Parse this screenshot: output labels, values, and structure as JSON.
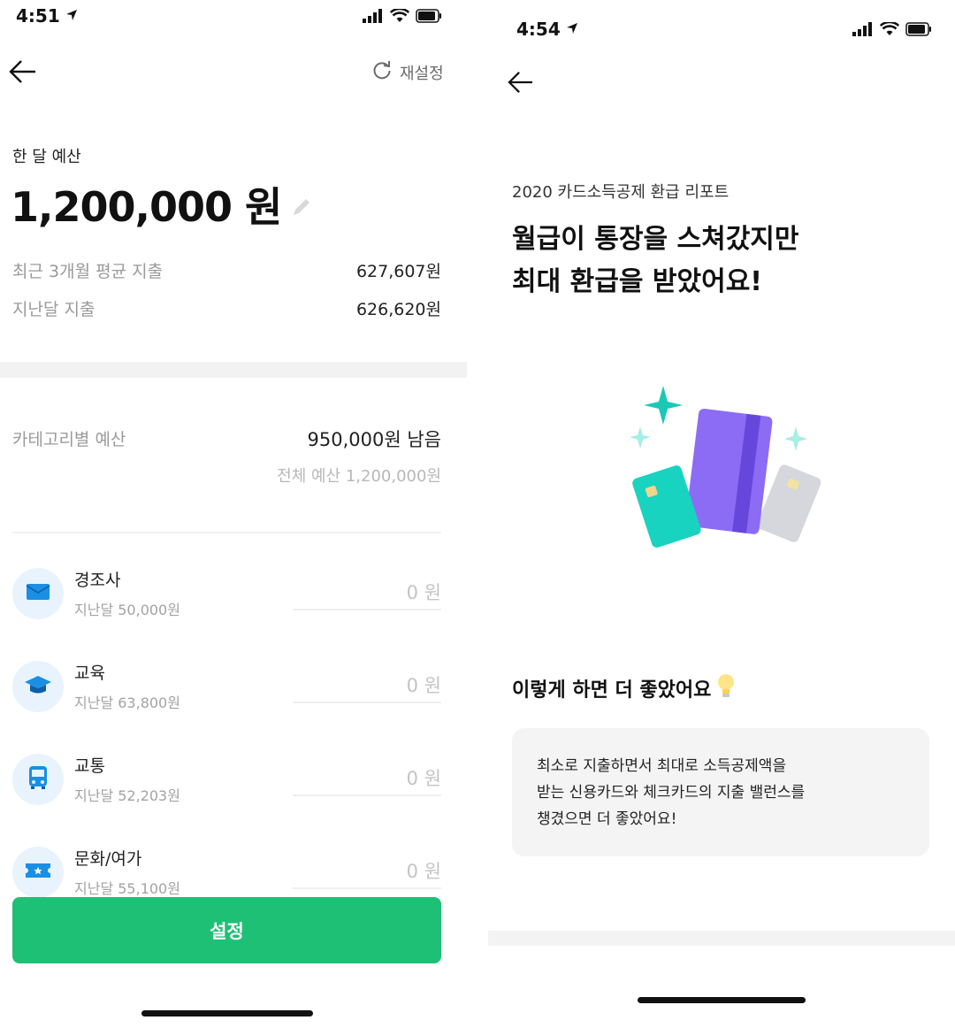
{
  "left": {
    "status": {
      "time": "4:51"
    },
    "header": {
      "reset_label": "재설정"
    },
    "budget": {
      "label": "한 달 예산",
      "amount": "1,200,000 원"
    },
    "stats": [
      {
        "label": "최근 3개월 평균 지출",
        "value": "627,607원"
      },
      {
        "label": "지난달 지출",
        "value": "626,620원"
      }
    ],
    "category_budget": {
      "label": "카테고리별 예산",
      "remaining": "950,000원 남음",
      "total": "전체 예산 1,200,000원"
    },
    "categories": [
      {
        "name": "경조사",
        "last_month": "지난달 50,000원",
        "value": "0 원",
        "icon": "envelope-icon"
      },
      {
        "name": "교육",
        "last_month": "지난달 63,800원",
        "value": "0 원",
        "icon": "graduation-cap-icon"
      },
      {
        "name": "교통",
        "last_month": "지난달 52,203원",
        "value": "0 원",
        "icon": "bus-icon"
      },
      {
        "name": "문화/여가",
        "last_month": "지난달 55,100원",
        "value": "0 원",
        "icon": "ticket-icon"
      }
    ],
    "cta_label": "설정"
  },
  "right": {
    "status": {
      "time": "4:54"
    },
    "report": {
      "subtitle": "2020 카드소득공제 환급 리포트",
      "title_line1": "월급이 통장을 스쳐갔지만",
      "title_line2": "최대 환급을 받았어요!"
    },
    "tip": {
      "heading": "이렇게 하면 더 좋았어요",
      "line1": "최소로 지출하면서 최대로 소득공제액을",
      "line2": "받는 신용카드와 체크카드의 지출 밸런스를",
      "line3": "챙겼으면 더 좋았어요!"
    }
  },
  "colors": {
    "primary_green": "#1ec075",
    "icon_blue": "#1a8fe3",
    "icon_bg": "#e8f3fd",
    "card_purple": "#8c6cf5",
    "card_teal": "#19d3c1"
  }
}
